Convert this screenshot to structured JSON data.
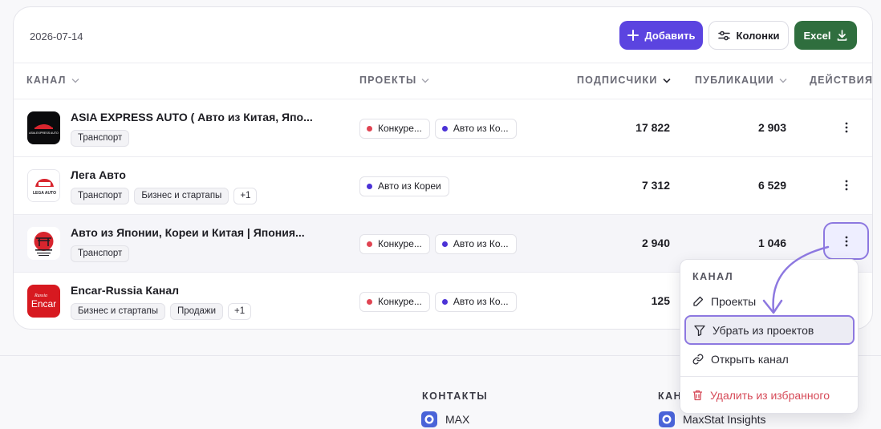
{
  "toolbar": {
    "date": "2026-07-14",
    "add_label": "Добавить",
    "columns_label": "Колонки",
    "excel_label": "Excel"
  },
  "table": {
    "headers": {
      "channel": "КАНАЛ",
      "projects": "ПРОЕКТЫ",
      "subscribers": "ПОДПИСЧИКИ",
      "publications": "ПУБЛИКАЦИИ",
      "actions": "ДЕЙСТВИЯ"
    },
    "rows": [
      {
        "name": "ASIA EXPRESS AUTO ( Авто из Китая, Япо...",
        "tags": [
          "Транспорт"
        ],
        "more": "",
        "projects": [
          {
            "label": "Конкуре...",
            "color": "#e04452"
          },
          {
            "label": "Авто из Ко...",
            "color": "#4b32d6"
          }
        ],
        "subscribers": "17 822",
        "publications": "2 903"
      },
      {
        "name": "Лега Авто",
        "tags": [
          "Транспорт",
          "Бизнес и стартапы"
        ],
        "more": "+1",
        "projects": [
          {
            "label": "Авто из Кореи",
            "color": "#4b32d6"
          }
        ],
        "subscribers": "7 312",
        "publications": "6 529"
      },
      {
        "name": "Авто из Японии, Кореи и Китая | Япония...",
        "tags": [
          "Транспорт"
        ],
        "more": "",
        "projects": [
          {
            "label": "Конкуре...",
            "color": "#e04452"
          },
          {
            "label": "Авто из Ко...",
            "color": "#4b32d6"
          }
        ],
        "subscribers": "2 940",
        "publications": "1 046"
      },
      {
        "name": "Encar-Russia Канал",
        "tags": [
          "Бизнес и стартапы",
          "Продажи"
        ],
        "more": "+1",
        "projects": [
          {
            "label": "Конкуре...",
            "color": "#e04452"
          },
          {
            "label": "Авто из Ко...",
            "color": "#4b32d6"
          }
        ],
        "subscribers": "125",
        "publications": ""
      }
    ]
  },
  "avatars": {
    "asia_caption": "ASIA EXPRESS AUTO",
    "lega_caption": "LEGA AUTO",
    "encar_script": "Russia",
    "encar_caption": "Encar"
  },
  "menu": {
    "header": "КАНАЛ",
    "items": {
      "projects": "Проекты",
      "remove_from_projects": "Убрать из проектов",
      "open_channel": "Открыть канал",
      "remove_favorite": "Удалить из избранного"
    }
  },
  "footer": {
    "contacts_heading": "КОНТАКТЫ",
    "channel_heading": "КАН",
    "contact_link": "MAX",
    "channel_link": "MaxStat Insights"
  },
  "colors": {
    "accent": "#5b44e0",
    "excel": "#2f6e3e",
    "highlight": "#8d78e0",
    "danger": "#d64a58",
    "project_red": "#e04452",
    "project_blue": "#4b32d6"
  }
}
